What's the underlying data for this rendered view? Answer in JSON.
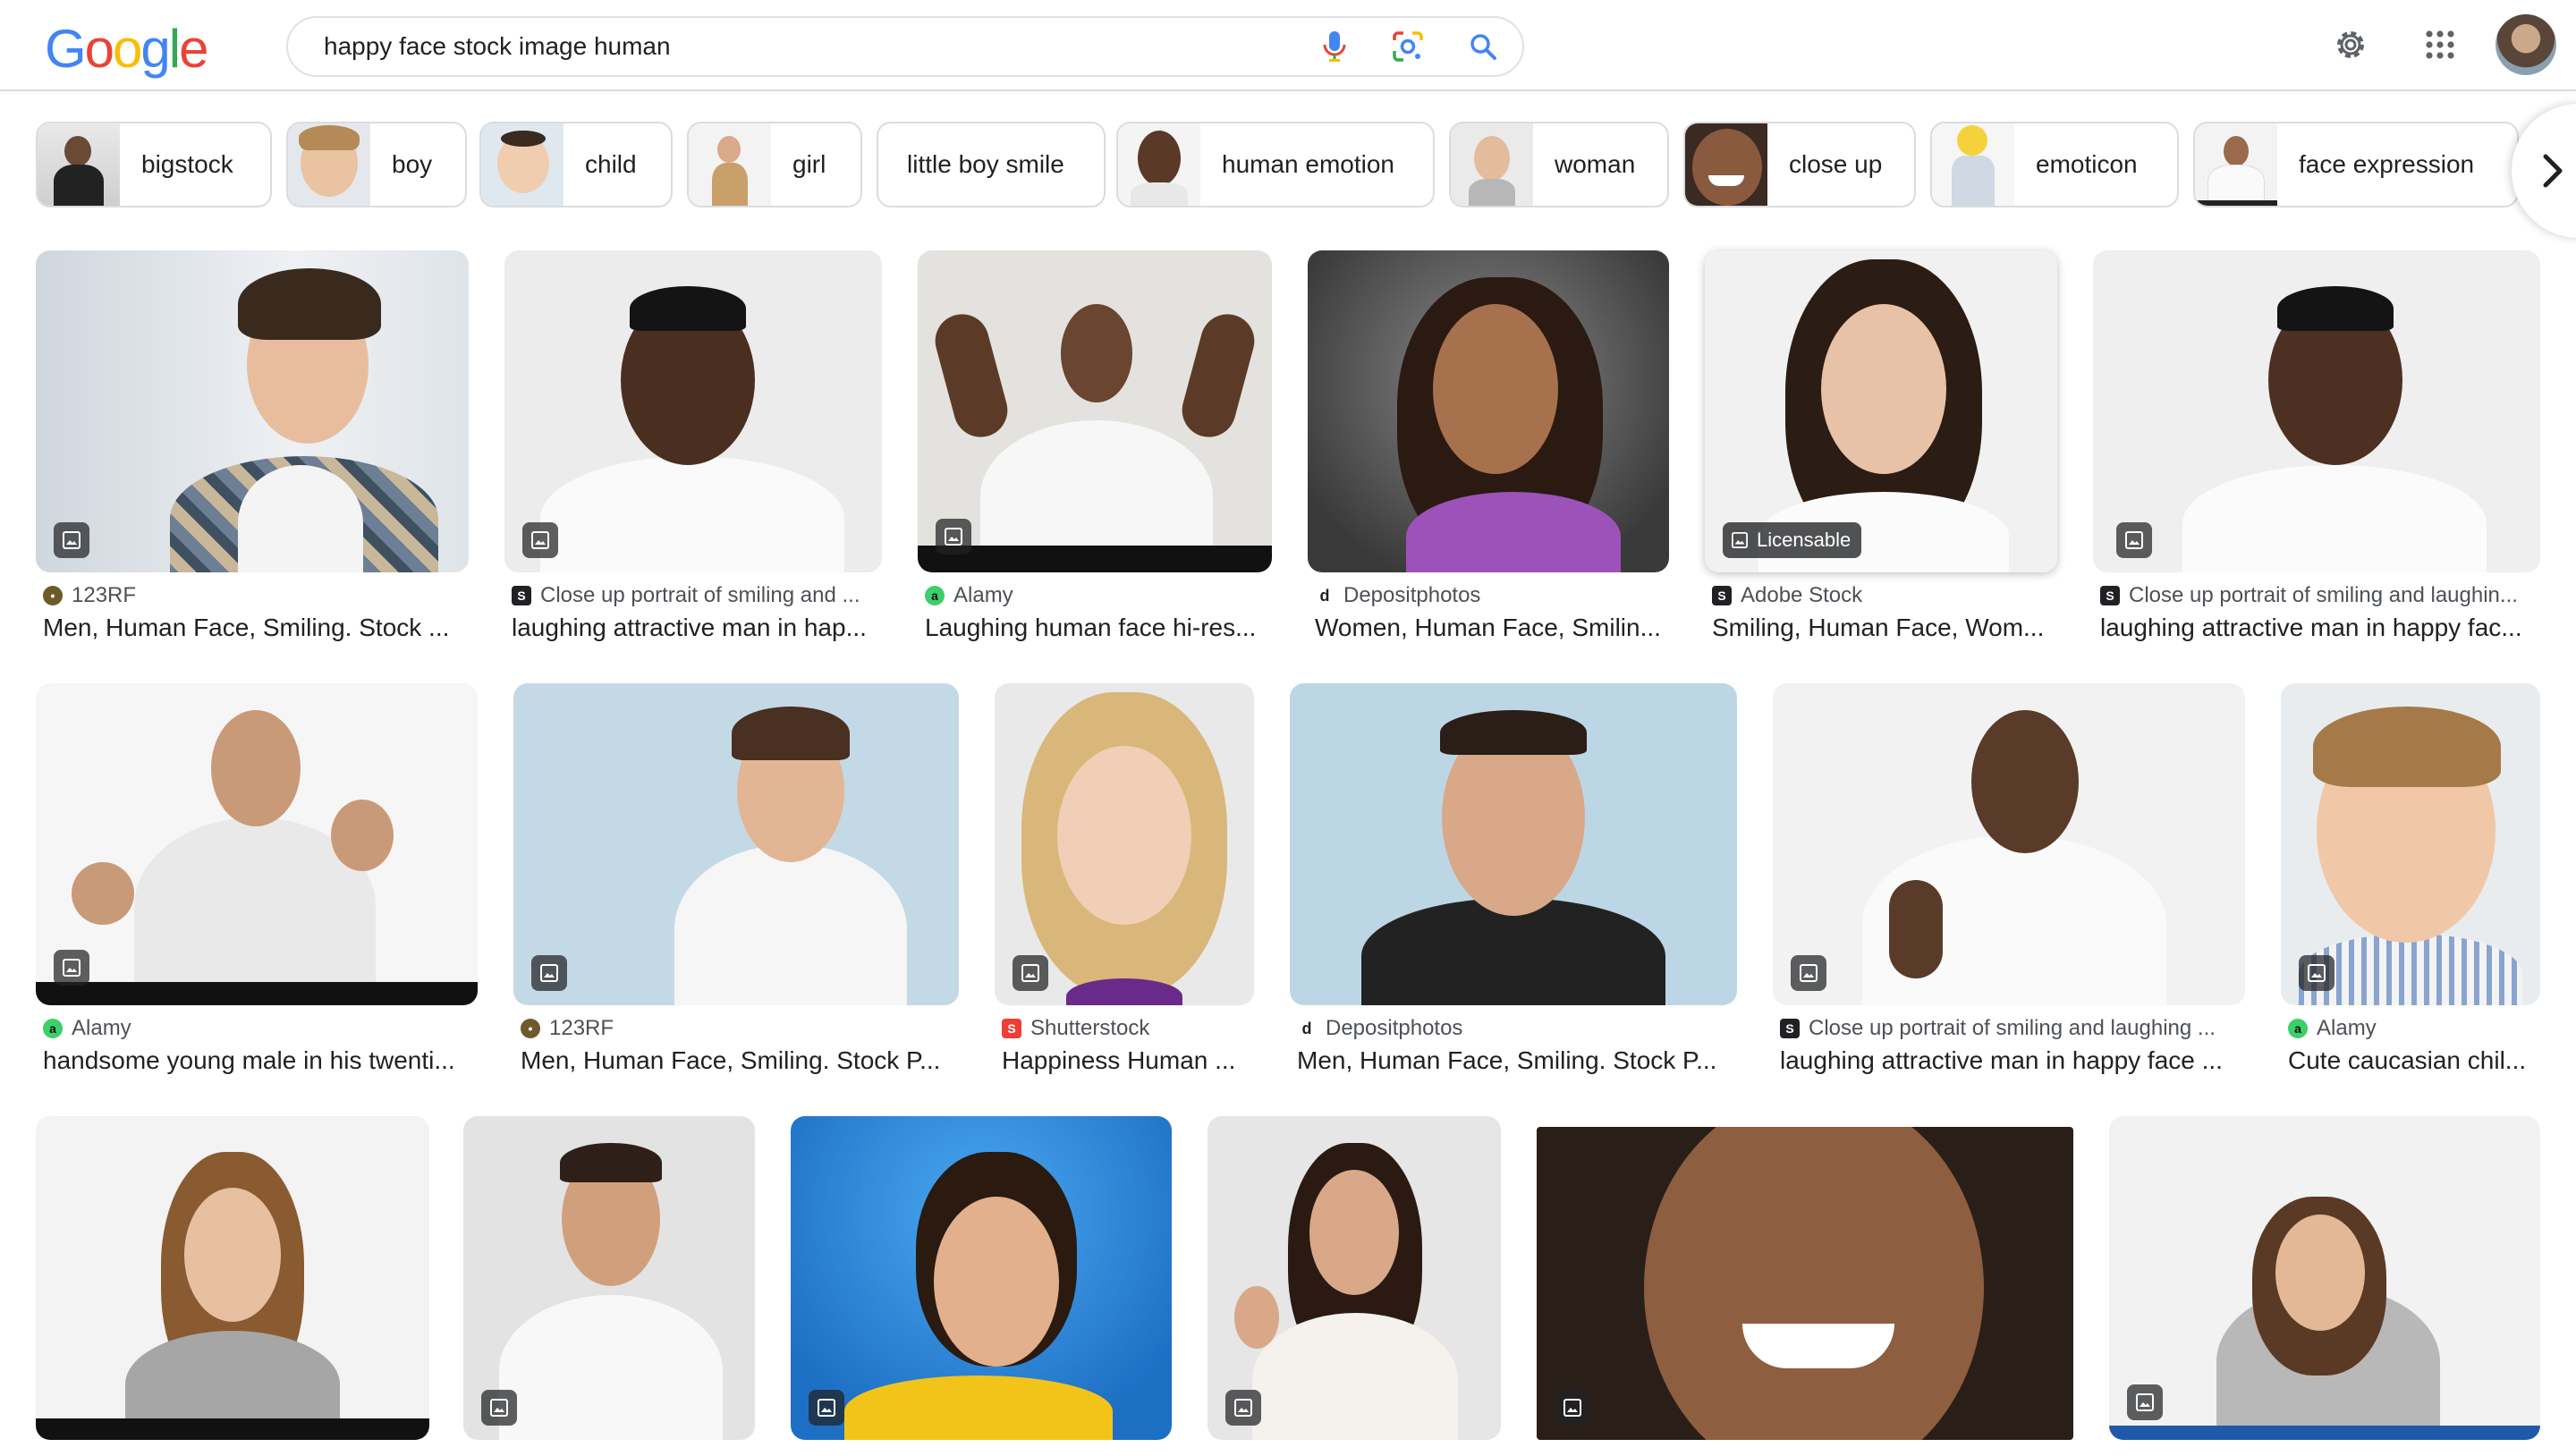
{
  "search": {
    "query": "happy face stock image human"
  },
  "colors": {
    "google_blue": "#4285F4",
    "google_red": "#EA4335",
    "google_yellow": "#FBBC05",
    "google_green": "#34A853"
  },
  "logo": {
    "letters": [
      "G",
      "o",
      "o",
      "g",
      "l",
      "e"
    ]
  },
  "chips": [
    {
      "label": "bigstock"
    },
    {
      "label": "boy"
    },
    {
      "label": "child"
    },
    {
      "label": "girl"
    },
    {
      "label": "little boy smile"
    },
    {
      "label": "human emotion"
    },
    {
      "label": "woman"
    },
    {
      "label": "close up"
    },
    {
      "label": "emoticon"
    },
    {
      "label": "face expression"
    }
  ],
  "results": [
    {
      "source": "123RF",
      "title": "Men, Human Face, Smiling. Stock ...",
      "badge": ""
    },
    {
      "source": "Close up portrait of smiling and ...",
      "title": "laughing attractive man in hap...",
      "badge": ""
    },
    {
      "source": "Alamy",
      "title": "Laughing human face hi-res...",
      "badge": ""
    },
    {
      "source": "Depositphotos",
      "title": "Women, Human Face, Smilin...",
      "badge": ""
    },
    {
      "source": "Adobe Stock",
      "title": "Smiling, Human Face, Wom...",
      "badge": "Licensable"
    },
    {
      "source": "Close up portrait of smiling and laughin...",
      "title": "laughing attractive man in happy fac...",
      "badge": ""
    },
    {
      "source": "Alamy",
      "title": "handsome young male in his twenti...",
      "badge": ""
    },
    {
      "source": "123RF",
      "title": "Men, Human Face, Smiling. Stock P...",
      "badge": ""
    },
    {
      "source": "Shutterstock",
      "title": "Happiness Human ...",
      "badge": ""
    },
    {
      "source": "Depositphotos",
      "title": "Men, Human Face, Smiling. Stock P...",
      "badge": ""
    },
    {
      "source": "Close up portrait of smiling and laughing ...",
      "title": "laughing attractive man in happy face ...",
      "badge": ""
    },
    {
      "source": "Alamy",
      "title": "Cute caucasian chil...",
      "badge": ""
    }
  ]
}
